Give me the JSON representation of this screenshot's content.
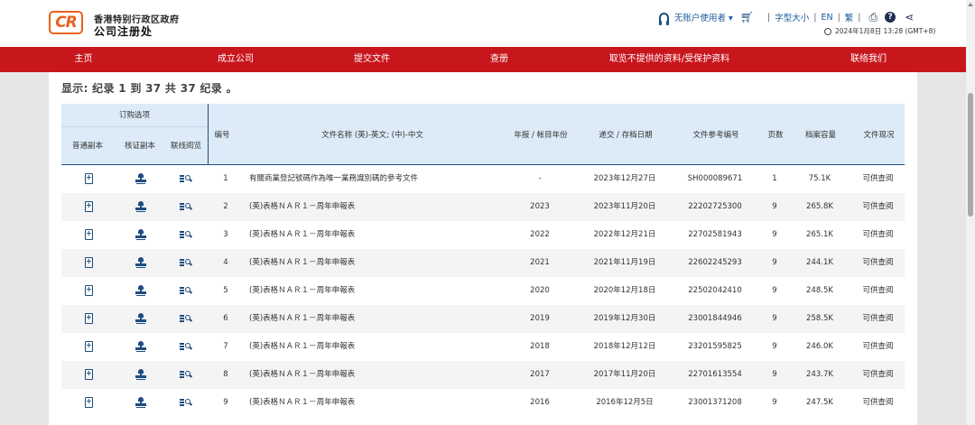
{
  "header": {
    "logo_text": "CR",
    "org_line1": "香港特别行政区政府",
    "org_line2": "公司注册处",
    "account_label": "无账户使用者",
    "font_size_label": "字型大小",
    "lang_en": "EN",
    "lang_trad": "繁",
    "help_label": "?",
    "datetime": "2024年1月8日 13:28 (GMT+8)"
  },
  "nav": {
    "items": [
      "主页",
      "成立公司",
      "提交文件",
      "查册",
      "取览不提供的资料/受保护资料",
      "联络我们"
    ]
  },
  "summary": {
    "text": "显示: 纪录 1 到 37 共 37 纪录 。"
  },
  "table": {
    "group_header": "订购选项",
    "sub_headers": [
      "普通副本",
      "核证副本",
      "联线阅览"
    ],
    "columns": [
      "编号",
      "文件名称 (英)-英文; (中)-中文",
      "年报 / 帐目年份",
      "递交 / 存档日期",
      "文件参考编号",
      "页数",
      "档案容量",
      "文件现况"
    ],
    "rows": [
      {
        "no": "1",
        "title": "有關商業登記號碼作為唯一業務識別碼的參考文件",
        "year": "-",
        "date": "2023年12月27日",
        "ref": "SH000089671",
        "pages": "1",
        "size": "75.1K",
        "status": "可供查阅"
      },
      {
        "no": "2",
        "title": "(英)表格ＮＡＲ１－周年申報表",
        "year": "2023",
        "date": "2023年11月20日",
        "ref": "22202725300",
        "pages": "9",
        "size": "265.8K",
        "status": "可供查阅"
      },
      {
        "no": "3",
        "title": "(英)表格ＮＡＲ１－周年申報表",
        "year": "2022",
        "date": "2022年12月21日",
        "ref": "22702581943",
        "pages": "9",
        "size": "265.1K",
        "status": "可供查阅"
      },
      {
        "no": "4",
        "title": "(英)表格ＮＡＲ１－周年申報表",
        "year": "2021",
        "date": "2021年11月19日",
        "ref": "22602245293",
        "pages": "9",
        "size": "244.1K",
        "status": "可供查阅"
      },
      {
        "no": "5",
        "title": "(英)表格ＮＡＲ１－周年申報表",
        "year": "2020",
        "date": "2020年12月18日",
        "ref": "22502042410",
        "pages": "9",
        "size": "248.5K",
        "status": "可供查阅"
      },
      {
        "no": "6",
        "title": "(英)表格ＮＡＲ１－周年申報表",
        "year": "2019",
        "date": "2019年12月30日",
        "ref": "23001844946",
        "pages": "9",
        "size": "258.5K",
        "status": "可供查阅"
      },
      {
        "no": "7",
        "title": "(英)表格ＮＡＲ１－周年申報表",
        "year": "2018",
        "date": "2018年12月12日",
        "ref": "23201595825",
        "pages": "9",
        "size": "246.0K",
        "status": "可供查阅"
      },
      {
        "no": "8",
        "title": "(英)表格ＮＡＲ１－周年申報表",
        "year": "2017",
        "date": "2017年11月20日",
        "ref": "22701613554",
        "pages": "9",
        "size": "243.7K",
        "status": "可供查阅"
      },
      {
        "no": "9",
        "title": "(英)表格ＮＡＲ１－周年申報表",
        "year": "2016",
        "date": "2016年12月5日",
        "ref": "23001371208",
        "pages": "9",
        "size": "247.5K",
        "status": "可供查阅"
      }
    ]
  },
  "colors": {
    "nav_bg": "#c8161d",
    "brand_orange": "#e8611a",
    "header_blue": "#dcebf7",
    "icon_blue": "#1e4d80"
  }
}
